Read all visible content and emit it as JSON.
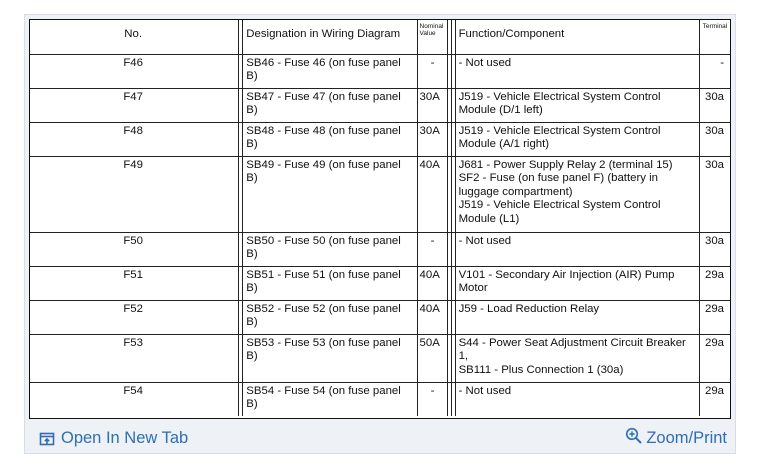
{
  "table": {
    "headers": {
      "no": "No.",
      "designation": "Designation in Wiring Diagram",
      "value": "Nominal Value",
      "function": "Function/Component",
      "terminal": "Terminal"
    },
    "rows": [
      {
        "no": "F46",
        "designation": "SB46 - Fuse 46 (on fuse panel B)",
        "value": "-",
        "function": "- Not used",
        "terminal": "-"
      },
      {
        "no": "F47",
        "designation": "SB47 - Fuse 47 (on fuse panel B)",
        "value": "30A",
        "function": "J519 - Vehicle Electrical System Control Module (D/1 left)",
        "terminal": "30a"
      },
      {
        "no": "F48",
        "designation": "SB48 - Fuse 48 (on fuse panel B)",
        "value": "30A",
        "function": "J519 - Vehicle Electrical System Control Module (A/1 right)",
        "terminal": "30a"
      },
      {
        "no": "F49",
        "designation": "SB49 - Fuse 49 (on fuse panel B)",
        "value": "40A",
        "function": "J681 - Power Supply Relay 2 (terminal 15)\nSF2 - Fuse (on fuse panel F) (battery in luggage compartment)\nJ519 - Vehicle Electrical System Control Module (L1)",
        "terminal": "30a"
      },
      {
        "no": "F50",
        "designation": "SB50 - Fuse 50 (on fuse panel B)",
        "value": "-",
        "function": "- Not used",
        "terminal": "30a"
      },
      {
        "no": "F51",
        "designation": "SB51 - Fuse 51 (on fuse panel B)",
        "value": "40A",
        "function": "V101 - Secondary Air Injection (AIR) Pump Motor",
        "terminal": "29a"
      },
      {
        "no": "F52",
        "designation": "SB52 - Fuse 52 (on fuse panel B)",
        "value": "40A",
        "function": "J59 - Load Reduction Relay",
        "terminal": "29a"
      },
      {
        "no": "F53",
        "designation": "SB53 - Fuse 53 (on fuse panel B)",
        "value": "50A",
        "function": "S44 - Power Seat Adjustment Circuit Breaker 1,\nSB111 - Plus Connection 1 (30a)",
        "terminal": "29a"
      },
      {
        "no": "F54",
        "designation": "SB54 - Fuse 54 (on fuse panel B)",
        "value": "-",
        "function": "- Not used",
        "terminal": "29a"
      }
    ]
  },
  "footer": {
    "open_tab_label": "Open In New Tab",
    "zoom_label": "Zoom/Print",
    "open_tab_icon": "open-new-tab-icon",
    "zoom_icon": "zoom-icon",
    "link_color": "#2f6fb1"
  }
}
